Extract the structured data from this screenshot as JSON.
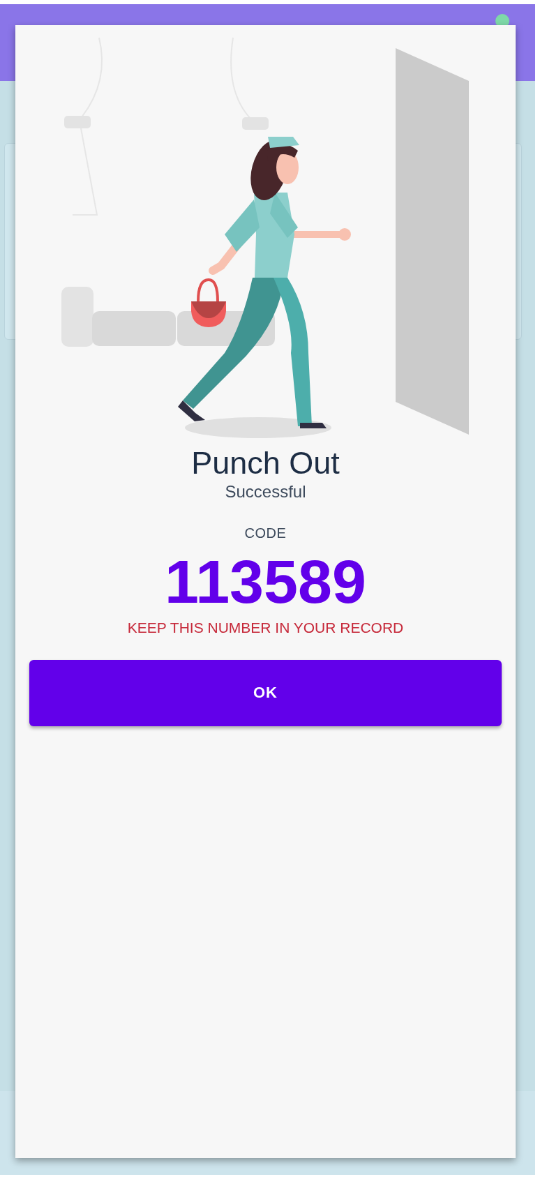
{
  "dialog": {
    "title": "Punch Out",
    "subtitle": "Successful",
    "code_label": "CODE",
    "code": "113589",
    "notice": "KEEP THIS NUMBER IN YOUR RECORD",
    "buttons": [
      "OK"
    ]
  }
}
